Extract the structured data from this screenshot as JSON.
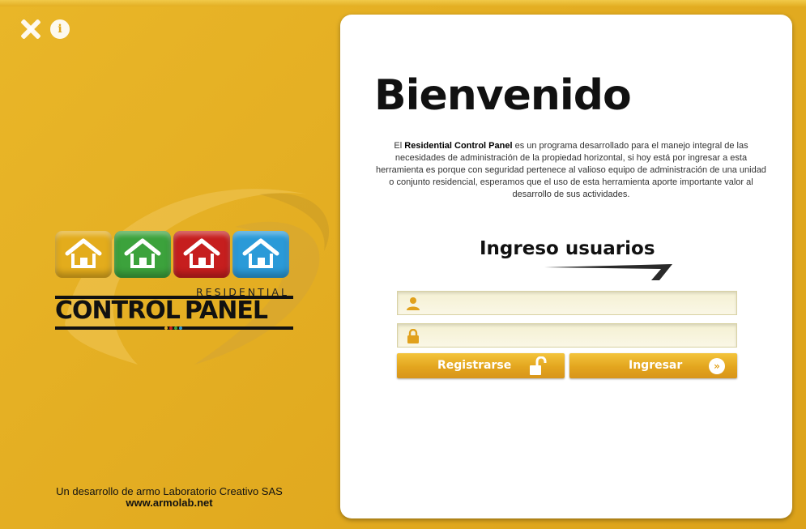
{
  "window": {
    "close_icon": "close-icon",
    "info_icon": "info-icon",
    "info_glyph": "i"
  },
  "brand": {
    "subtitle": "RESIDENTIAL",
    "title_left": "CONTROL",
    "title_right": "PANEL",
    "house_colors": [
      "#e3ac1c",
      "#3ca23c",
      "#c61e1e",
      "#2a9ad8"
    ],
    "dot_colors": [
      "#e3ac1c",
      "#c61e1e",
      "#3ca23c",
      "#2a9ad8"
    ]
  },
  "credit": {
    "line1": "Un desarrollo de armo Laboratorio Creativo SAS",
    "website": "www.armolab.net"
  },
  "main": {
    "welcome_title": "Bienvenido",
    "intro_prefix": "El ",
    "intro_bold": "Residential Control Panel",
    "intro_rest": " es un programa desarrollado para el manejo integral de las necesidades de administración de la propiedad horizontal, si hoy está por ingresar a esta herramienta es porque con seguridad pertenece al valioso equipo de administración de una unidad o conjunto residencial, esperamos que el uso de esta herramienta aporte importante valor al desarrollo de sus actividades."
  },
  "login": {
    "title": "Ingreso usuarios",
    "username_value": "",
    "password_value": "",
    "register_label": "Registrarse",
    "login_label": "Ingresar",
    "login_glyph": "»"
  },
  "colors": {
    "background": "#e4b020",
    "button": "#e3a51e",
    "field": "#f4f0d2"
  }
}
